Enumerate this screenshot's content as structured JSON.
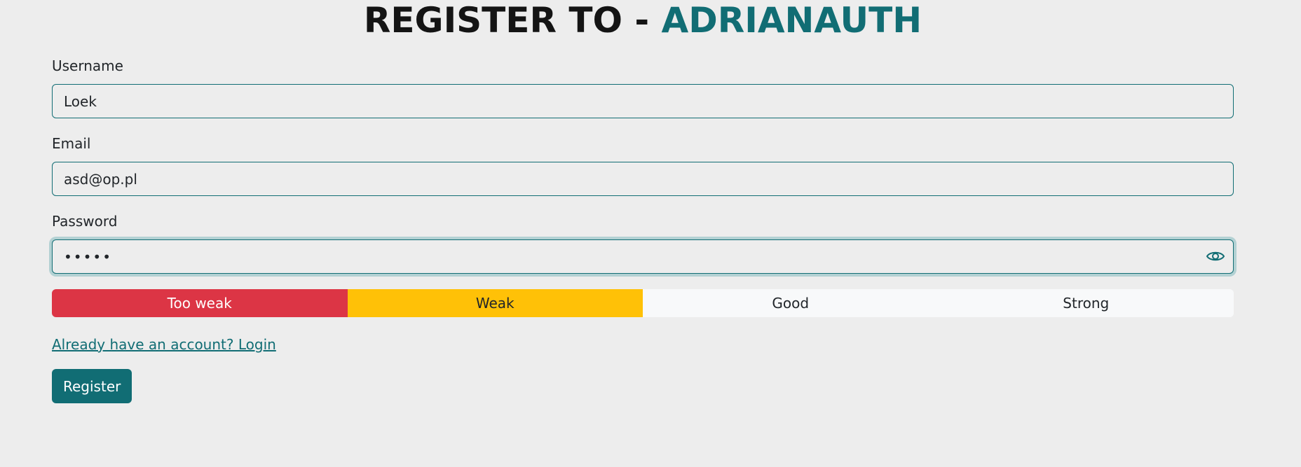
{
  "header": {
    "title_prefix": "REGISTER TO - ",
    "title_brand": "ADRIANAUTH"
  },
  "form": {
    "username": {
      "label": "Username",
      "value": "Loek"
    },
    "email": {
      "label": "Email",
      "value": "asd@op.pl"
    },
    "password": {
      "label": "Password",
      "value": "asdfg",
      "toggle_icon": "eye-icon"
    },
    "strength": {
      "levels": [
        "Too weak",
        "Weak",
        "Good",
        "Strong"
      ],
      "colors": [
        "#dc3545",
        "#ffc107",
        "#f8f9fa",
        "#f8f9fa"
      ],
      "current": "Weak"
    },
    "login_link": "Already have an account? Login",
    "submit_label": "Register"
  },
  "theme": {
    "accent": "#116d74",
    "background": "#ededed"
  }
}
